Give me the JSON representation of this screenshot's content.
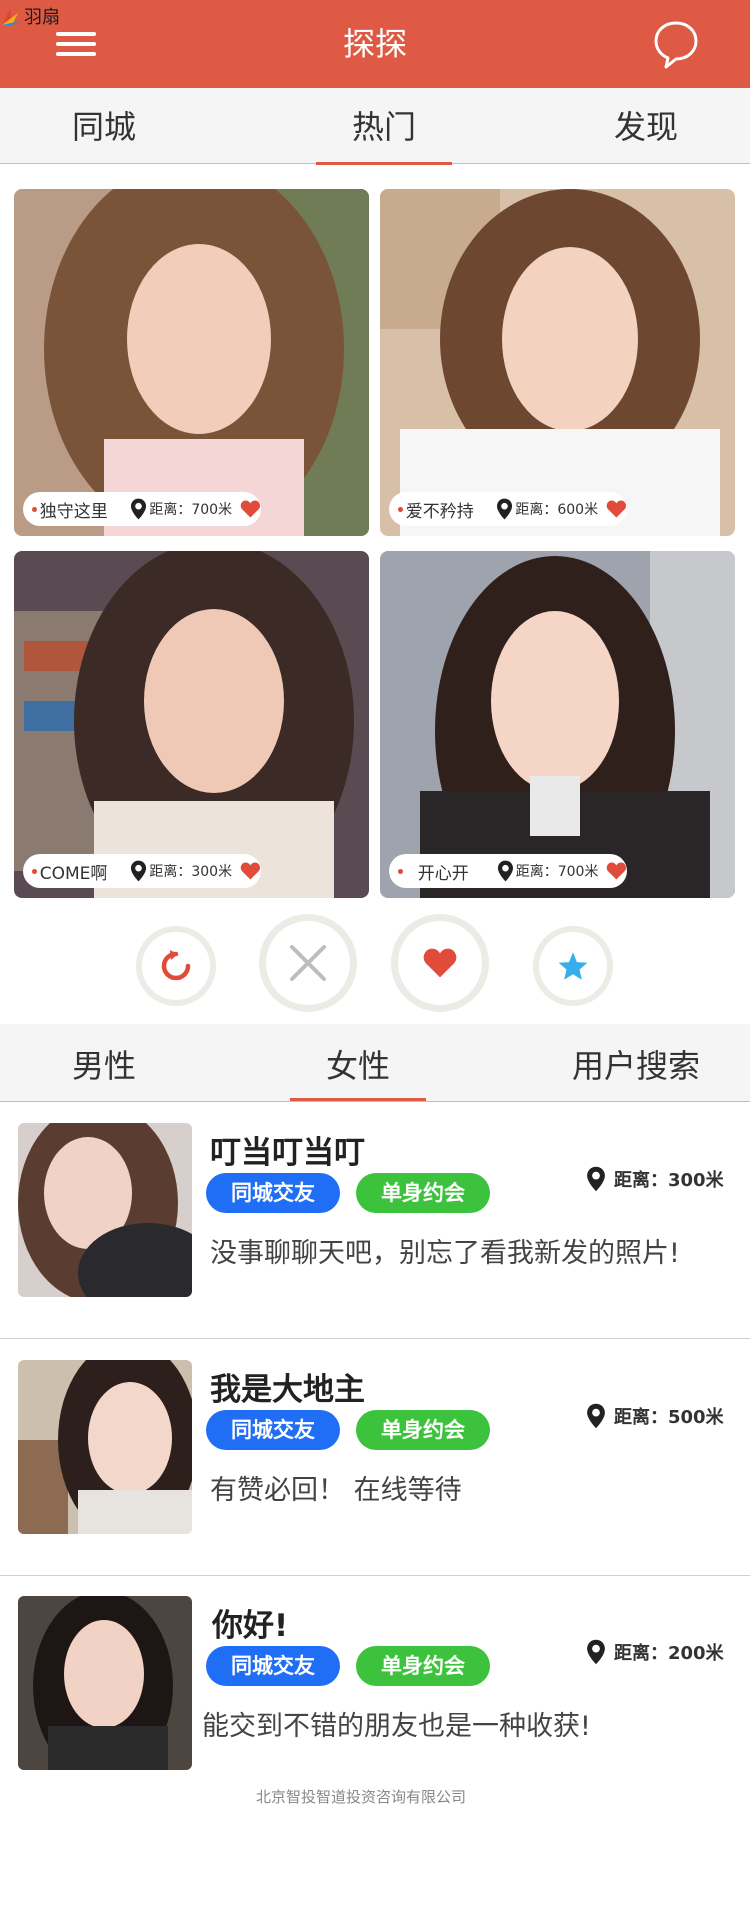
{
  "watermark": {
    "text": "羽扇"
  },
  "header": {
    "title": "探探"
  },
  "top_tabs": [
    {
      "label": "同城"
    },
    {
      "label": "热门"
    },
    {
      "label": "发现"
    }
  ],
  "active_top_tab": "热门",
  "cards": [
    {
      "name": "独守这里",
      "distance": "距离：700米"
    },
    {
      "name": "爱不矜持",
      "distance": "距离：600米"
    },
    {
      "name": "COME啊",
      "distance": "距离：300米"
    },
    {
      "name": "开心开",
      "distance": "距离：700米"
    }
  ],
  "actions": [
    {
      "icon": "refresh-icon"
    },
    {
      "icon": "close-icon"
    },
    {
      "icon": "heart-icon"
    },
    {
      "icon": "star-icon"
    }
  ],
  "gender_tabs": [
    {
      "label": "男性"
    },
    {
      "label": "女性"
    },
    {
      "label": "用户搜索"
    }
  ],
  "active_gender_tab": "女性",
  "users": [
    {
      "name": "叮当叮当叮",
      "tags": [
        "同城交友",
        "单身约会"
      ],
      "distance": "距离：300米",
      "bio": "没事聊聊天吧，别忘了看我新发的照片!"
    },
    {
      "name": "我是大地主",
      "tags": [
        "同城交友",
        "单身约会"
      ],
      "distance": "距离：500米",
      "bio": "有赞必回！ 在线等待"
    },
    {
      "name": "你好!",
      "tags": [
        "同城交友",
        "单身约会"
      ],
      "distance": "距离：200米",
      "bio": "能交到不错的朋友也是一种收获!"
    }
  ],
  "footer": {
    "text": "北京智投智道投资咨询有限公司"
  },
  "colors": {
    "brand": "#de5a45",
    "tag_blue": "#1f6ef5",
    "tag_green": "#3cc23c",
    "heart": "#e04b3a",
    "star": "#35aeea"
  }
}
